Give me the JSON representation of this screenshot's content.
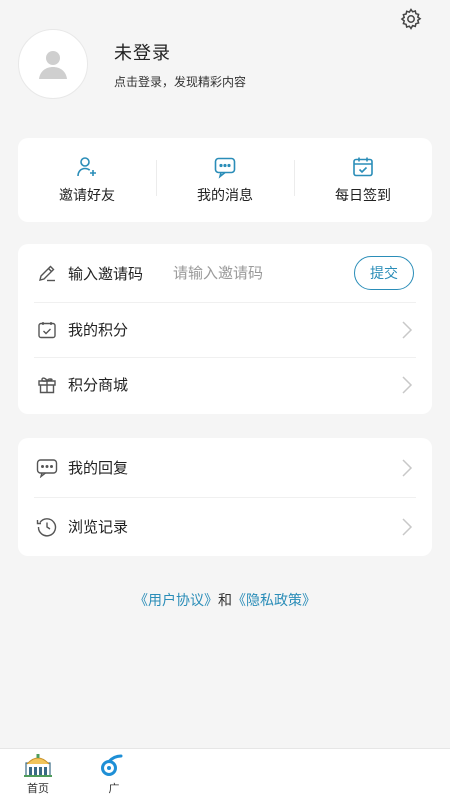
{
  "header": {
    "user_name": "未登录",
    "user_subtitle": "点击登录，发现精彩内容"
  },
  "quick_actions": [
    {
      "label": "邀请好友",
      "icon": "add-user-icon"
    },
    {
      "label": "我的消息",
      "icon": "message-icon"
    },
    {
      "label": "每日签到",
      "icon": "calendar-check-icon"
    }
  ],
  "invite": {
    "label": "输入邀请码",
    "placeholder": "请输入邀请码",
    "submit_label": "提交"
  },
  "menu1": [
    {
      "label": "我的积分",
      "icon": "points-icon"
    },
    {
      "label": "积分商城",
      "icon": "shop-icon"
    }
  ],
  "menu2": [
    {
      "label": "我的回复",
      "icon": "reply-icon"
    },
    {
      "label": "浏览记录",
      "icon": "history-icon"
    }
  ],
  "agreement": {
    "user_agreement": "《用户协议》",
    "and": "和",
    "privacy_policy": "《隐私政策》"
  },
  "tabs": [
    {
      "label": "首页",
      "icon": "home-building-icon"
    },
    {
      "label": "广",
      "icon": "broadcast-icon"
    }
  ],
  "colors": {
    "accent": "#2a8db8",
    "background": "#f5f5f5",
    "card": "#ffffff"
  }
}
